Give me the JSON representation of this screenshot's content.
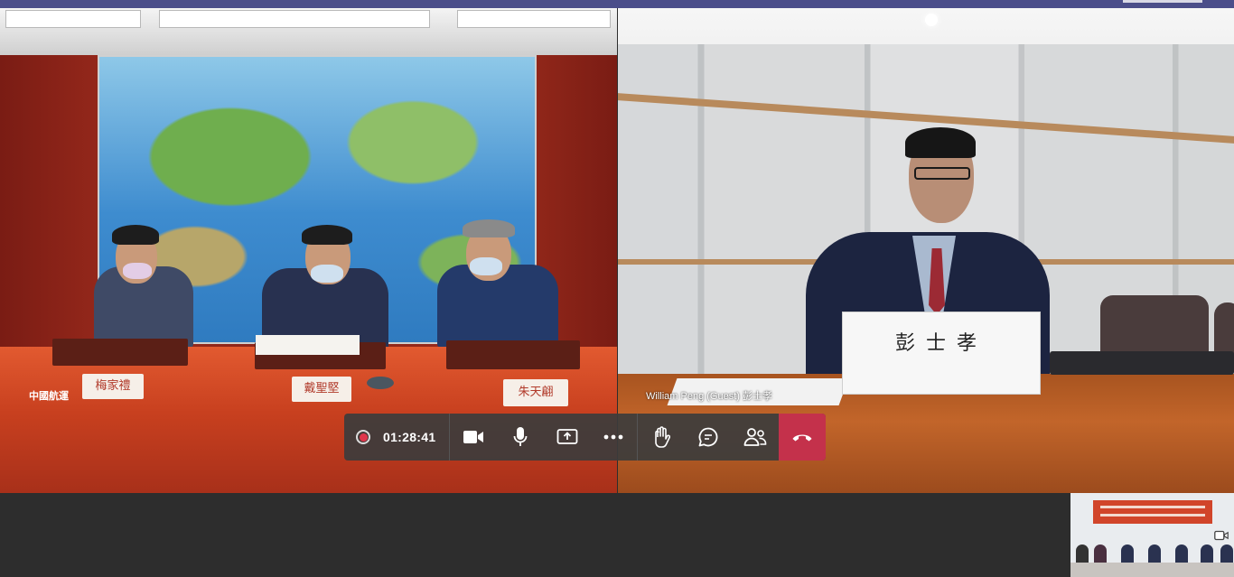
{
  "window": {
    "topbar_color": "#4b4e8a"
  },
  "tiles": {
    "left": {
      "company_label": "中國航運",
      "nameplates": [
        "梅家禮",
        "戴聖堅",
        "朱天翩"
      ]
    },
    "right": {
      "nameplate": "彭士孝",
      "participant_label": "William Peng (Guest) 彭士孝"
    }
  },
  "call_controls": {
    "record_icon": "record-icon",
    "timer": "01:28:41",
    "camera_icon": "camera-icon",
    "mic_icon": "microphone-icon",
    "share_icon": "share-screen-icon",
    "more_icon": "more-options-icon",
    "raise_hand_icon": "raise-hand-icon",
    "chat_icon": "chat-icon",
    "participants_icon": "participants-icon",
    "hangup_icon": "hang-up-icon",
    "hangup_color": "#c4314b"
  },
  "self_view": {
    "camera_icon": "camera-toggle-icon"
  }
}
